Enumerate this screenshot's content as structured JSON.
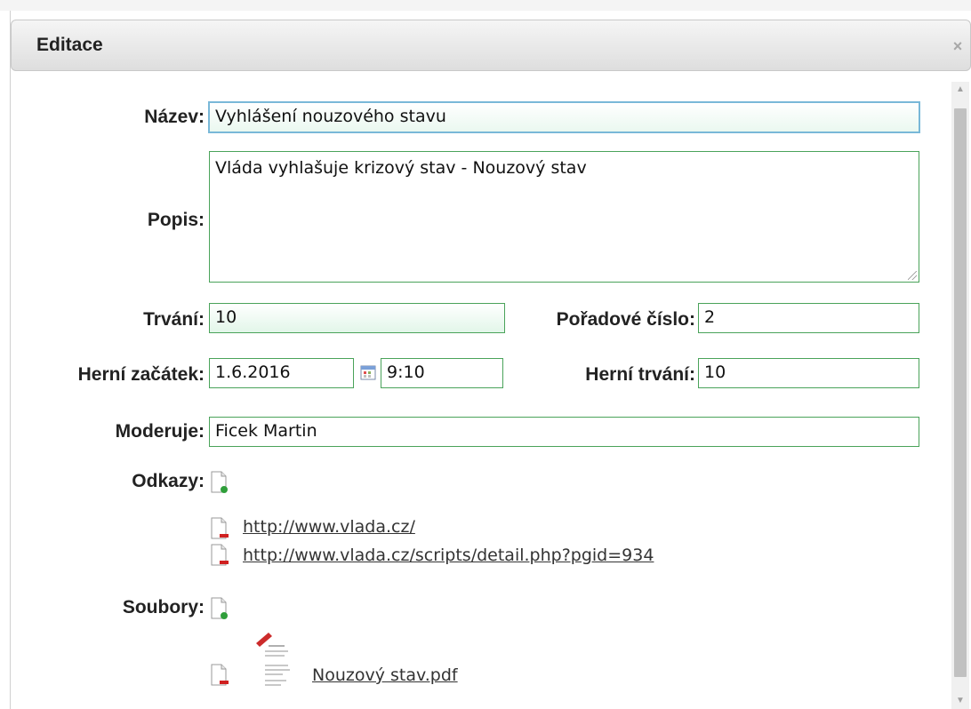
{
  "dialog": {
    "title": "Editace",
    "close_glyph": "×"
  },
  "form": {
    "nazev": {
      "label": "Název:",
      "value": "Vyhlášení nouzového stavu"
    },
    "popis": {
      "label": "Popis:",
      "value": "Vláda vyhlašuje krizový stav - Nouzový stav"
    },
    "trvani": {
      "label": "Trvání:",
      "value": "10"
    },
    "poradove_cislo": {
      "label": "Pořadové číslo:",
      "value": "2"
    },
    "herni_zacatek": {
      "label": "Herní začátek:",
      "date": "1.6.2016",
      "time": "9:10"
    },
    "herni_trvani": {
      "label": "Herní trvání:",
      "value": "10"
    },
    "moderuje": {
      "label": "Moderuje:",
      "value": "Ficek Martin"
    },
    "odkazy": {
      "label": "Odkazy:",
      "items": [
        {
          "text": "http://www.vlada.cz/"
        },
        {
          "text": "http://www.vlada.cz/scripts/detail.php?pgid=934"
        }
      ]
    },
    "soubory": {
      "label": "Soubory:",
      "items": [
        {
          "text": "Nouzový stav.pdf"
        }
      ]
    }
  },
  "icons": {
    "add": "document-add-icon",
    "remove": "document-remove-icon",
    "calendar": "calendar-icon",
    "pdf": "pdf-thumbnail-icon",
    "close": "close-icon"
  },
  "colors": {
    "field_border": "#4aa35a",
    "focus_border": "#79b8d8",
    "add_accent": "#2f9e3a",
    "remove_accent": "#d02020"
  }
}
